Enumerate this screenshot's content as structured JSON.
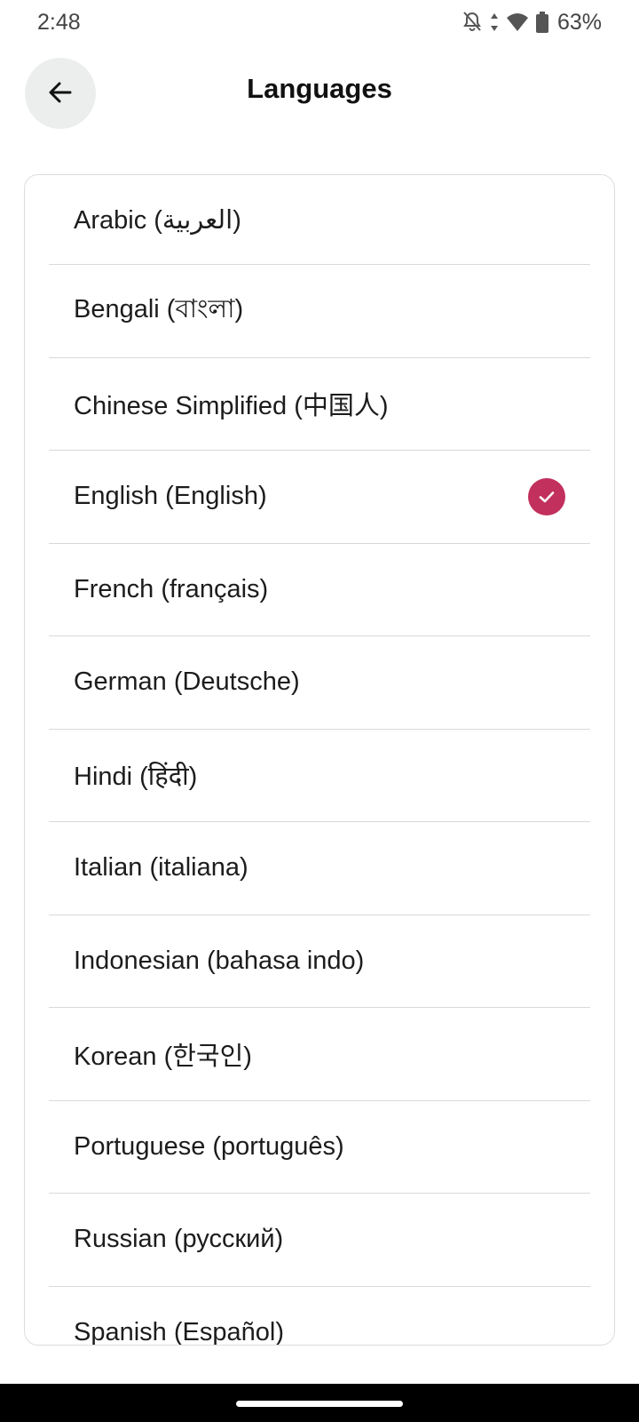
{
  "status_bar": {
    "time": "2:48",
    "battery": "63%",
    "icons": [
      "notifications-off-icon",
      "data-arrows-icon",
      "wifi-icon",
      "battery-icon"
    ]
  },
  "header": {
    "title": "Languages",
    "back_icon": "arrow-left-icon"
  },
  "languages": [
    {
      "label": "Arabic (العربية)",
      "selected": false
    },
    {
      "label": "Bengali (বাংলা)",
      "selected": false
    },
    {
      "label": "Chinese Simplified (中国人)",
      "selected": false
    },
    {
      "label": "English (English)",
      "selected": true
    },
    {
      "label": "French (français)",
      "selected": false
    },
    {
      "label": "German (Deutsche)",
      "selected": false
    },
    {
      "label": "Hindi (हिंदी)",
      "selected": false
    },
    {
      "label": "Italian (italiana)",
      "selected": false
    },
    {
      "label": "Indonesian (bahasa indo)",
      "selected": false
    },
    {
      "label": "Korean (한국인)",
      "selected": false
    },
    {
      "label": "Portuguese (português)",
      "selected": false
    },
    {
      "label": "Russian (русский)",
      "selected": false
    },
    {
      "label": "Spanish (Español)",
      "selected": false
    }
  ],
  "colors": {
    "accent": "#c2305e",
    "back_button_bg": "#eceeed",
    "divider": "#d9d9d9"
  },
  "check_icon": "check-icon"
}
